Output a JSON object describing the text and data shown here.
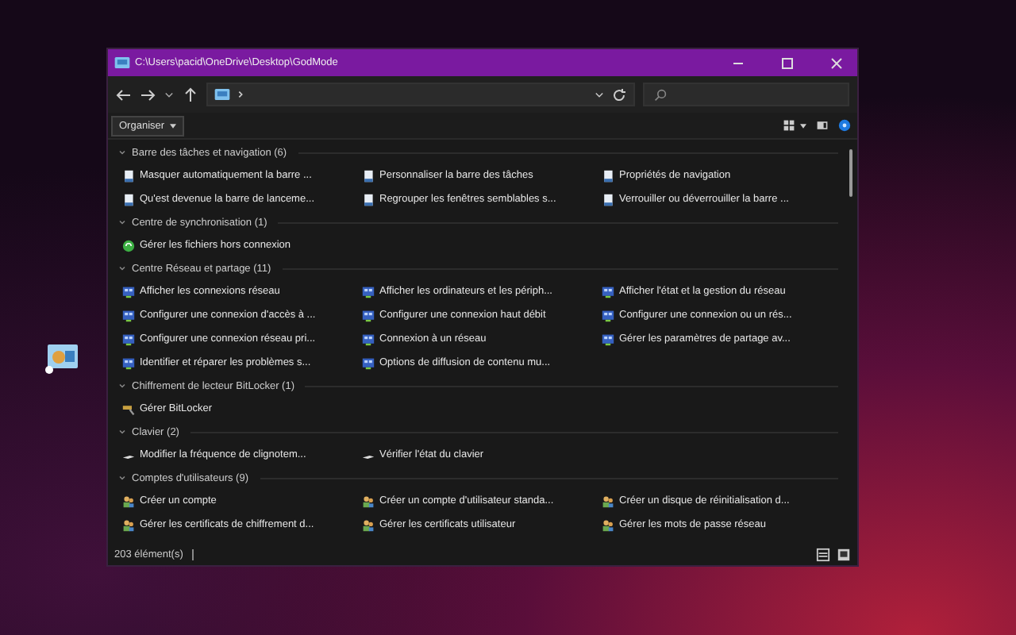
{
  "window": {
    "title": "C:\\Users\\pacid\\OneDrive\\Desktop\\GodMode"
  },
  "toolbar": {
    "organise_label": "Organiser"
  },
  "groups": [
    {
      "header": "Barre des tâches et navigation (6)",
      "expanded": true,
      "items": [
        {
          "label": "Masquer automatiquement la barre ...",
          "kind": "taskbar"
        },
        {
          "label": "Personnaliser la barre des tâches",
          "kind": "taskbar"
        },
        {
          "label": "Propriétés de navigation",
          "kind": "taskbar"
        },
        {
          "label": "Qu'est devenue la barre de lanceme...",
          "kind": "taskbar"
        },
        {
          "label": "Regrouper les fenêtres semblables s...",
          "kind": "taskbar"
        },
        {
          "label": "Verrouiller ou déverrouiller la barre ...",
          "kind": "taskbar"
        }
      ]
    },
    {
      "header": "Centre de synchronisation (1)",
      "expanded": true,
      "items": [
        {
          "label": "Gérer les fichiers hors connexion",
          "kind": "sync"
        }
      ]
    },
    {
      "header": "Centre Réseau et partage (11)",
      "expanded": true,
      "items": [
        {
          "label": "Afficher les connexions réseau",
          "kind": "network"
        },
        {
          "label": "Afficher les ordinateurs et les périph...",
          "kind": "network"
        },
        {
          "label": "Afficher l'état et la gestion du réseau",
          "kind": "network"
        },
        {
          "label": "Configurer une connexion d'accès à ...",
          "kind": "network"
        },
        {
          "label": "Configurer une connexion haut débit",
          "kind": "network"
        },
        {
          "label": "Configurer une connexion ou un rés...",
          "kind": "network"
        },
        {
          "label": "Configurer une connexion réseau pri...",
          "kind": "network"
        },
        {
          "label": "Connexion à un réseau",
          "kind": "network"
        },
        {
          "label": "Gérer les paramètres de partage av...",
          "kind": "network"
        },
        {
          "label": "Identifier et réparer les problèmes s...",
          "kind": "network"
        },
        {
          "label": "Options de diffusion de contenu mu...",
          "kind": "network"
        }
      ]
    },
    {
      "header": "Chiffrement de lecteur BitLocker (1)",
      "expanded": true,
      "items": [
        {
          "label": "Gérer BitLocker",
          "kind": "bitlocker"
        }
      ]
    },
    {
      "header": "Clavier (2)",
      "expanded": true,
      "items": [
        {
          "label": "Modifier la fréquence de clignotem...",
          "kind": "keyboard"
        },
        {
          "label": "Vérifier l'état du clavier",
          "kind": "keyboard"
        }
      ]
    },
    {
      "header": "Comptes d'utilisateurs (9)",
      "expanded": true,
      "items": [
        {
          "label": "Créer un compte",
          "kind": "users"
        },
        {
          "label": "Créer un compte d'utilisateur standa...",
          "kind": "users"
        },
        {
          "label": "Créer un disque de réinitialisation d...",
          "kind": "users"
        },
        {
          "label": "Gérer les certificats de chiffrement d...",
          "kind": "users"
        },
        {
          "label": "Gérer les certificats utilisateur",
          "kind": "users"
        },
        {
          "label": "Gérer les mots de passe réseau",
          "kind": "users"
        }
      ]
    }
  ],
  "status_bar": {
    "count": "203 élément(s)"
  }
}
